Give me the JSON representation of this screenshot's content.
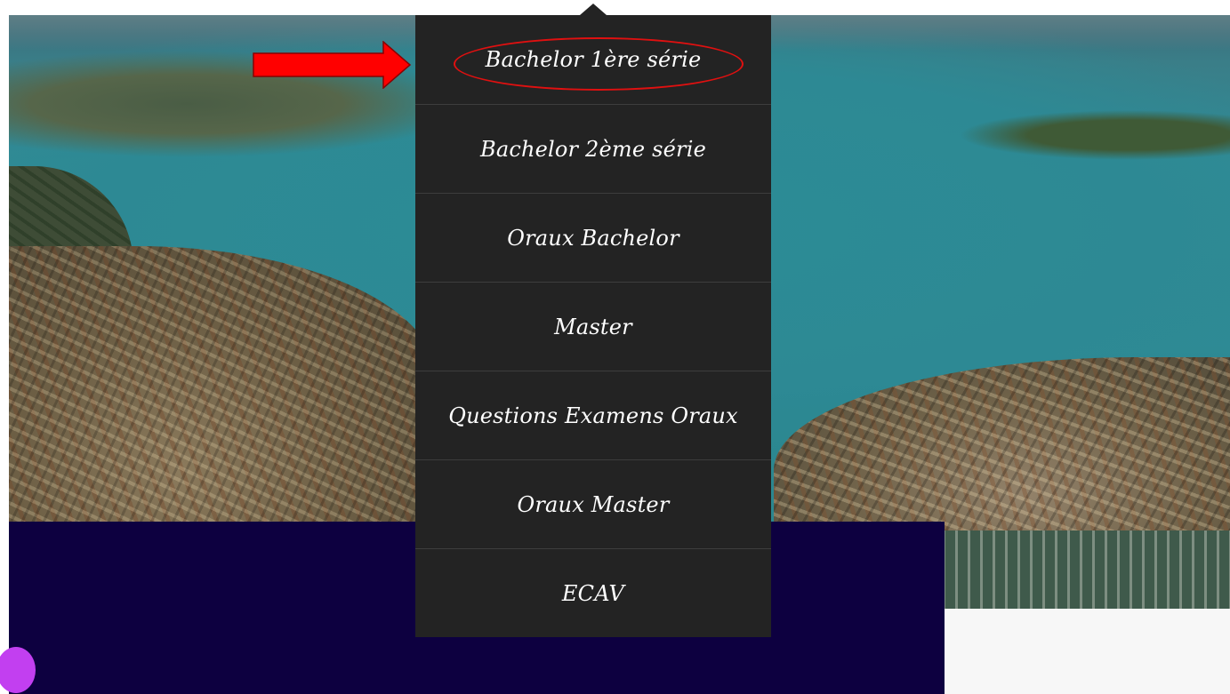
{
  "menu": {
    "items": [
      {
        "label": "Bachelor 1ère série"
      },
      {
        "label": "Bachelor 2ème série"
      },
      {
        "label": "Oraux Bachelor"
      },
      {
        "label": "Master"
      },
      {
        "label": "Questions Examens Oraux"
      },
      {
        "label": "Oraux Master"
      },
      {
        "label": "ECAV"
      }
    ],
    "highlighted_index": 0
  },
  "colors": {
    "menu_background": "#232323",
    "menu_text": "#ffffff",
    "navy_panel": "#0d0040",
    "chat_bubble": "#c23ff0",
    "annotation": "#e01010",
    "arrow_fill": "#ff0000"
  },
  "icons": {
    "chat_launcher": "chat-bubble-icon",
    "annotation_arrow": "red-arrow-annotation"
  }
}
